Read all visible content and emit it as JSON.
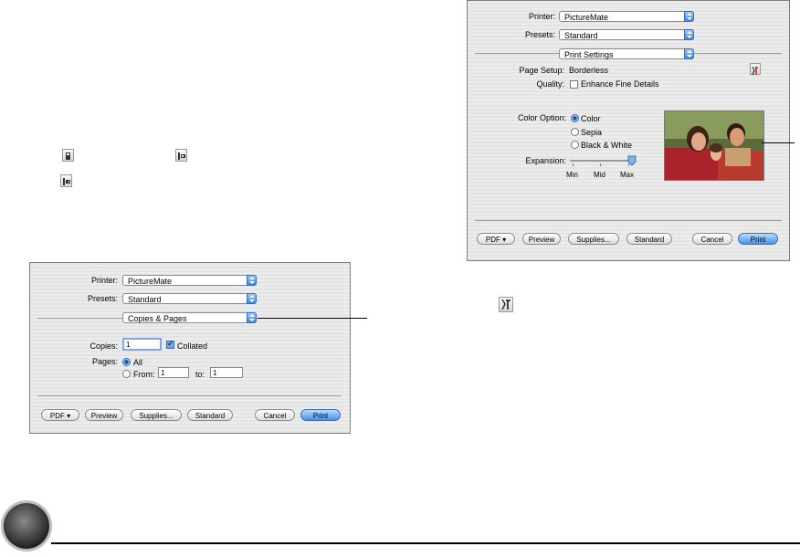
{
  "settings_dialog": {
    "printer_label": "Printer:",
    "printer_value": "PictureMate",
    "presets_label": "Presets:",
    "presets_value": "Standard",
    "panel_value": "Print Settings",
    "page_setup_label": "Page Setup:",
    "page_setup_value": "Borderless",
    "quality_label": "Quality:",
    "enhance_label": "Enhance Fine Details",
    "enhance_checked": false,
    "color_option_label": "Color Option:",
    "color_options": [
      "Color",
      "Sepia",
      "Black & White"
    ],
    "selected_color_option": "Color",
    "expansion_label": "Expansion:",
    "expansion_ticks": [
      "Min",
      "Mid",
      "Max"
    ],
    "expansion_value": "Max",
    "buttons": {
      "pdf": "PDF ▾",
      "preview": "Preview",
      "supplies": "Supplies...",
      "standard": "Standard",
      "cancel": "Cancel",
      "print": "Print"
    }
  },
  "copies_dialog": {
    "printer_label": "Printer:",
    "printer_value": "PictureMate",
    "presets_label": "Presets:",
    "presets_value": "Standard",
    "panel_value": "Copies & Pages",
    "copies_label": "Copies:",
    "copies_value": "1",
    "collated_label": "Collated",
    "collated_checked": true,
    "pages_label": "Pages:",
    "all_label": "All",
    "from_label": "From:",
    "from_value": "1",
    "to_label": "to:",
    "to_value": "1",
    "buttons": {
      "pdf": "PDF ▾",
      "preview": "Preview",
      "supplies": "Supplies...",
      "standard": "Standard",
      "cancel": "Cancel",
      "print": "Print"
    }
  },
  "icons": [
    "portrait-orientation-icon",
    "landscape-left-icon",
    "landscape-right-icon",
    "borderless-tool-icon",
    "step-bullet-icon"
  ],
  "colors": {
    "accent_blue": "#4a90e8",
    "dialog_bg": "#e6e6e6"
  }
}
